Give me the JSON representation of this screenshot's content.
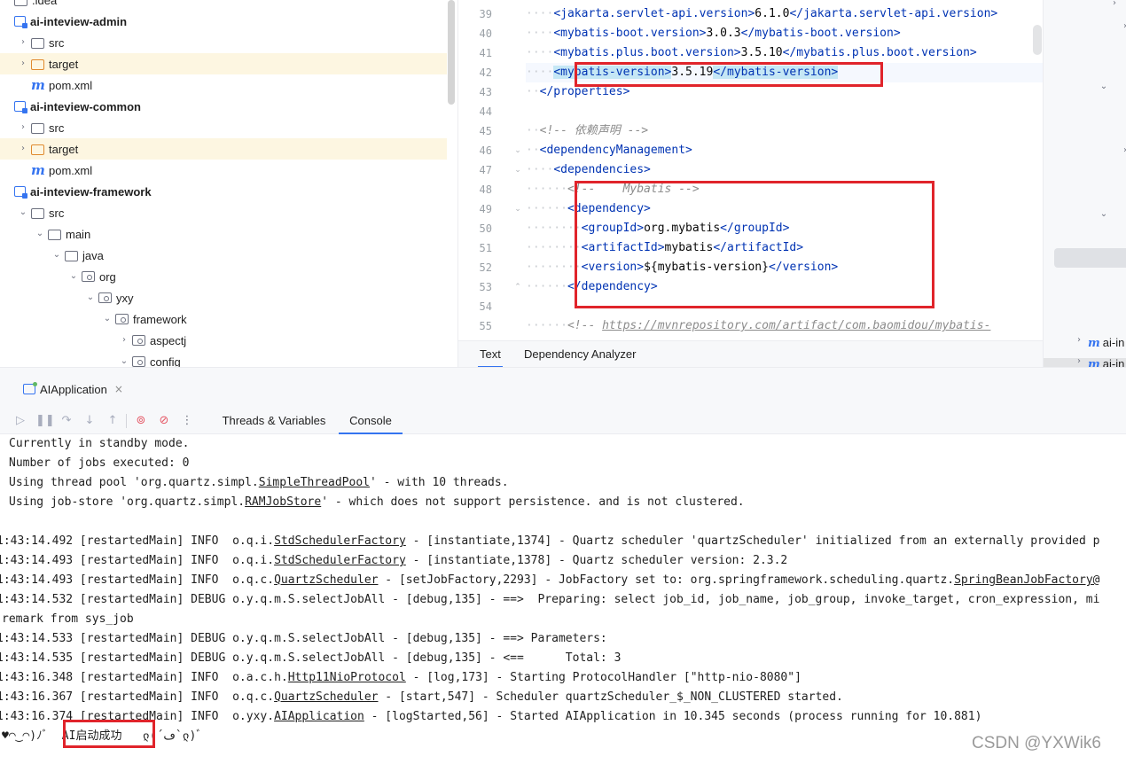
{
  "project_tree": {
    "items": [
      {
        "label": ".idea",
        "icon": "folder-icon",
        "indent": 0,
        "arrow": "none",
        "bold": false,
        "highlight": false
      },
      {
        "label": "ai-inteview-admin",
        "icon": "module-folder-icon",
        "indent": 0,
        "arrow": "none",
        "bold": true,
        "highlight": false
      },
      {
        "label": "src",
        "icon": "folder-icon",
        "indent": 1,
        "arrow": "collapsed",
        "bold": false,
        "highlight": false
      },
      {
        "label": "target",
        "icon": "folder-orange-icon",
        "indent": 1,
        "arrow": "collapsed",
        "bold": false,
        "highlight": true
      },
      {
        "label": "pom.xml",
        "icon": "maven-icon",
        "indent": 1,
        "arrow": "none",
        "bold": false,
        "highlight": false
      },
      {
        "label": "ai-inteview-common",
        "icon": "module-folder-icon",
        "indent": 0,
        "arrow": "none",
        "bold": true,
        "highlight": false
      },
      {
        "label": "src",
        "icon": "folder-icon",
        "indent": 1,
        "arrow": "collapsed",
        "bold": false,
        "highlight": false
      },
      {
        "label": "target",
        "icon": "folder-orange-icon",
        "indent": 1,
        "arrow": "collapsed",
        "bold": false,
        "highlight": true
      },
      {
        "label": "pom.xml",
        "icon": "maven-icon",
        "indent": 1,
        "arrow": "none",
        "bold": false,
        "highlight": false
      },
      {
        "label": "ai-inteview-framework",
        "icon": "module-folder-icon",
        "indent": 0,
        "arrow": "none",
        "bold": true,
        "highlight": false
      },
      {
        "label": "src",
        "icon": "folder-icon",
        "indent": 1,
        "arrow": "expanded",
        "bold": false,
        "highlight": false
      },
      {
        "label": "main",
        "icon": "folder-icon",
        "indent": 2,
        "arrow": "expanded",
        "bold": false,
        "highlight": false
      },
      {
        "label": "java",
        "icon": "folder-icon",
        "indent": 3,
        "arrow": "expanded",
        "bold": false,
        "highlight": false
      },
      {
        "label": "org",
        "icon": "package-icon",
        "indent": 4,
        "arrow": "expanded",
        "bold": false,
        "highlight": false
      },
      {
        "label": "yxy",
        "icon": "package-icon",
        "indent": 5,
        "arrow": "expanded",
        "bold": false,
        "highlight": false
      },
      {
        "label": "framework",
        "icon": "package-icon",
        "indent": 6,
        "arrow": "expanded",
        "bold": false,
        "highlight": false
      },
      {
        "label": "aspectj",
        "icon": "package-icon",
        "indent": 7,
        "arrow": "collapsed",
        "bold": false,
        "highlight": false
      },
      {
        "label": "config",
        "icon": "package-icon",
        "indent": 7,
        "arrow": "expanded",
        "bold": false,
        "highlight": false
      }
    ]
  },
  "editor": {
    "current_line": "42",
    "lines": [
      {
        "num": "39",
        "indent": 4,
        "fold": "",
        "segments": [
          {
            "t": "<jakarta.servlet-api.version>",
            "c": "tag"
          },
          {
            "t": "6.1.0",
            "c": ""
          },
          {
            "t": "</jakarta.servlet-api.version>",
            "c": "tag"
          }
        ]
      },
      {
        "num": "40",
        "indent": 4,
        "fold": "",
        "segments": [
          {
            "t": "<mybatis-boot.version>",
            "c": "tag"
          },
          {
            "t": "3.0.3",
            "c": ""
          },
          {
            "t": "</mybatis-boot.version>",
            "c": "tag"
          }
        ]
      },
      {
        "num": "41",
        "indent": 4,
        "fold": "",
        "segments": [
          {
            "t": "<mybatis.plus.boot.version>",
            "c": "tag"
          },
          {
            "t": "3.5.10",
            "c": ""
          },
          {
            "t": "</mybatis.plus.boot.version>",
            "c": "tag"
          }
        ]
      },
      {
        "num": "42",
        "indent": 4,
        "fold": "",
        "segments": [
          {
            "t": "<mybatis-version>",
            "c": "tag hl-tag"
          },
          {
            "t": "3.5.19",
            "c": ""
          },
          {
            "t": "</mybatis-version>",
            "c": "tag hl-tag"
          }
        ]
      },
      {
        "num": "43",
        "indent": 2,
        "fold": "",
        "segments": [
          {
            "t": "</properties>",
            "c": "tag"
          }
        ]
      },
      {
        "num": "44",
        "indent": 0,
        "fold": "",
        "segments": []
      },
      {
        "num": "45",
        "indent": 2,
        "fold": "",
        "segments": [
          {
            "t": "<!-- 依赖声明 -->",
            "c": "cmt"
          }
        ]
      },
      {
        "num": "46",
        "indent": 2,
        "fold": "⌄",
        "segments": [
          {
            "t": "<dependencyManagement>",
            "c": "tag"
          }
        ]
      },
      {
        "num": "47",
        "indent": 4,
        "fold": "⌄",
        "segments": [
          {
            "t": "<dependencies>",
            "c": "tag"
          }
        ]
      },
      {
        "num": "48",
        "indent": 6,
        "fold": "",
        "segments": [
          {
            "t": "<!--    Mybatis -->",
            "c": "cmt"
          }
        ]
      },
      {
        "num": "49",
        "indent": 6,
        "fold": "⌄",
        "segments": [
          {
            "t": "<dependency>",
            "c": "tag"
          }
        ]
      },
      {
        "num": "50",
        "indent": 8,
        "fold": "",
        "segments": [
          {
            "t": "<groupId>",
            "c": "tag"
          },
          {
            "t": "org.mybatis",
            "c": ""
          },
          {
            "t": "</groupId>",
            "c": "tag"
          }
        ]
      },
      {
        "num": "51",
        "indent": 8,
        "fold": "",
        "segments": [
          {
            "t": "<artifactId>",
            "c": "tag"
          },
          {
            "t": "mybatis",
            "c": ""
          },
          {
            "t": "</artifactId>",
            "c": "tag"
          }
        ]
      },
      {
        "num": "52",
        "indent": 8,
        "fold": "",
        "segments": [
          {
            "t": "<version>",
            "c": "tag"
          },
          {
            "t": "${mybatis-version}",
            "c": ""
          },
          {
            "t": "</version>",
            "c": "tag"
          }
        ]
      },
      {
        "num": "53",
        "indent": 6,
        "fold": "⌃",
        "segments": [
          {
            "t": "</dependency>",
            "c": "tag"
          }
        ]
      },
      {
        "num": "54",
        "indent": 0,
        "fold": "",
        "segments": []
      },
      {
        "num": "55",
        "indent": 6,
        "fold": "",
        "segments": [
          {
            "t": "<!-- ",
            "c": "cmt"
          },
          {
            "t": "https://mvnrepository.com/artifact/com.baomidou/mybatis-",
            "c": "lnk"
          }
        ]
      }
    ],
    "bottom_tabs": [
      "Text",
      "Dependency Analyzer"
    ],
    "active_bottom_tab": "Text"
  },
  "right_panel": {
    "items": [
      {
        "label": "ai-in",
        "row": "a"
      },
      {
        "label": "ai-in",
        "row": "b"
      }
    ]
  },
  "run_window": {
    "tab_label": "AIApplication",
    "close_glyph": "×",
    "toolbar_tabs": [
      "Threads & Variables",
      "Console"
    ],
    "active_tab": "Console"
  },
  "console": {
    "lines": [
      {
        "x": 10,
        "segments": [
          {
            "t": "Currently in standby mode.",
            "u": false
          }
        ]
      },
      {
        "x": 10,
        "segments": [
          {
            "t": "Number of jobs executed: 0",
            "u": false
          }
        ]
      },
      {
        "x": 10,
        "segments": [
          {
            "t": "Using thread pool 'org.quartz.simpl.",
            "u": false
          },
          {
            "t": "SimpleThreadPool",
            "u": true
          },
          {
            "t": "' - with 10 threads.",
            "u": false
          }
        ]
      },
      {
        "x": 10,
        "segments": [
          {
            "t": "Using job-store 'org.quartz.simpl.",
            "u": false
          },
          {
            "t": "RAMJobStore",
            "u": true
          },
          {
            "t": "' - which does not support persistence. and is not clustered.",
            "u": false
          }
        ]
      },
      {
        "x": 0,
        "segments": []
      },
      {
        "x": -4,
        "segments": [
          {
            "t": "1:43:14.492 [restartedMain] INFO  o.q.i.",
            "u": false
          },
          {
            "t": "StdSchedulerFactory",
            "u": true
          },
          {
            "t": " - [instantiate,1374] - Quartz scheduler 'quartzScheduler' initialized from an externally provided p",
            "u": false
          }
        ]
      },
      {
        "x": -4,
        "segments": [
          {
            "t": "1:43:14.493 [restartedMain] INFO  o.q.i.",
            "u": false
          },
          {
            "t": "StdSchedulerFactory",
            "u": true
          },
          {
            "t": " - [instantiate,1378] - Quartz scheduler version: 2.3.2",
            "u": false
          }
        ]
      },
      {
        "x": -4,
        "segments": [
          {
            "t": "1:43:14.493 [restartedMain] INFO  o.q.c.",
            "u": false
          },
          {
            "t": "QuartzScheduler",
            "u": true
          },
          {
            "t": " - [setJobFactory,2293] - JobFactory set to: org.springframework.scheduling.quartz.",
            "u": false
          },
          {
            "t": "SpringBeanJobFactory@",
            "u": true
          }
        ]
      },
      {
        "x": -4,
        "segments": [
          {
            "t": "1:43:14.532 [restartedMain] DEBUG o.y.q.m.S.selectJobAll - [debug,135] - ==>  Preparing: select job_id, job_name, job_group, invoke_target, cron_expression, mi",
            "u": false
          }
        ]
      },
      {
        "x": 2,
        "segments": [
          {
            "t": "remark from sys_job",
            "u": false
          }
        ]
      },
      {
        "x": -4,
        "segments": [
          {
            "t": "1:43:14.533 [restartedMain] DEBUG o.y.q.m.S.selectJobAll - [debug,135] - ==> Parameters: ",
            "u": false
          }
        ]
      },
      {
        "x": -4,
        "segments": [
          {
            "t": "1:43:14.535 [restartedMain] DEBUG o.y.q.m.S.selectJobAll - [debug,135] - <==      Total: 3",
            "u": false
          }
        ]
      },
      {
        "x": -4,
        "segments": [
          {
            "t": "1:43:16.348 [restartedMain] INFO  o.a.c.h.",
            "u": false
          },
          {
            "t": "Http11NioProtocol",
            "u": true
          },
          {
            "t": " - [log,173] - Starting ProtocolHandler [\"http-nio-8080\"]",
            "u": false
          }
        ]
      },
      {
        "x": -4,
        "segments": [
          {
            "t": "1:43:16.367 [restartedMain] INFO  o.q.c.",
            "u": false
          },
          {
            "t": "QuartzScheduler",
            "u": true
          },
          {
            "t": " - [start,547] - Scheduler quartzScheduler_$_NON_CLUSTERED started.",
            "u": false
          }
        ]
      },
      {
        "x": -4,
        "segments": [
          {
            "t": "1:43:16.374 [restartedMain] INFO  o.yxy.",
            "u": false
          },
          {
            "t": "AIApplication",
            "u": true
          },
          {
            "t": " - [logStarted,56] - Started AIApplication in 10.345 seconds (process running for 10.881)",
            "u": false
          }
        ]
      },
      {
        "x": 2,
        "segments": [
          {
            "t": "♥◠‿◠)ﾉﾞ  AI启动成功   ლ(´ڡ`ლ)ﾞ",
            "u": false
          }
        ]
      }
    ]
  },
  "watermark": "CSDN @YXWik6",
  "colors": {
    "accent": "#3574f0",
    "tag": "#0033b3",
    "comment": "#8c8c8c",
    "annotation_red": "#e0242b",
    "highlight_row": "#fdf6e1"
  }
}
